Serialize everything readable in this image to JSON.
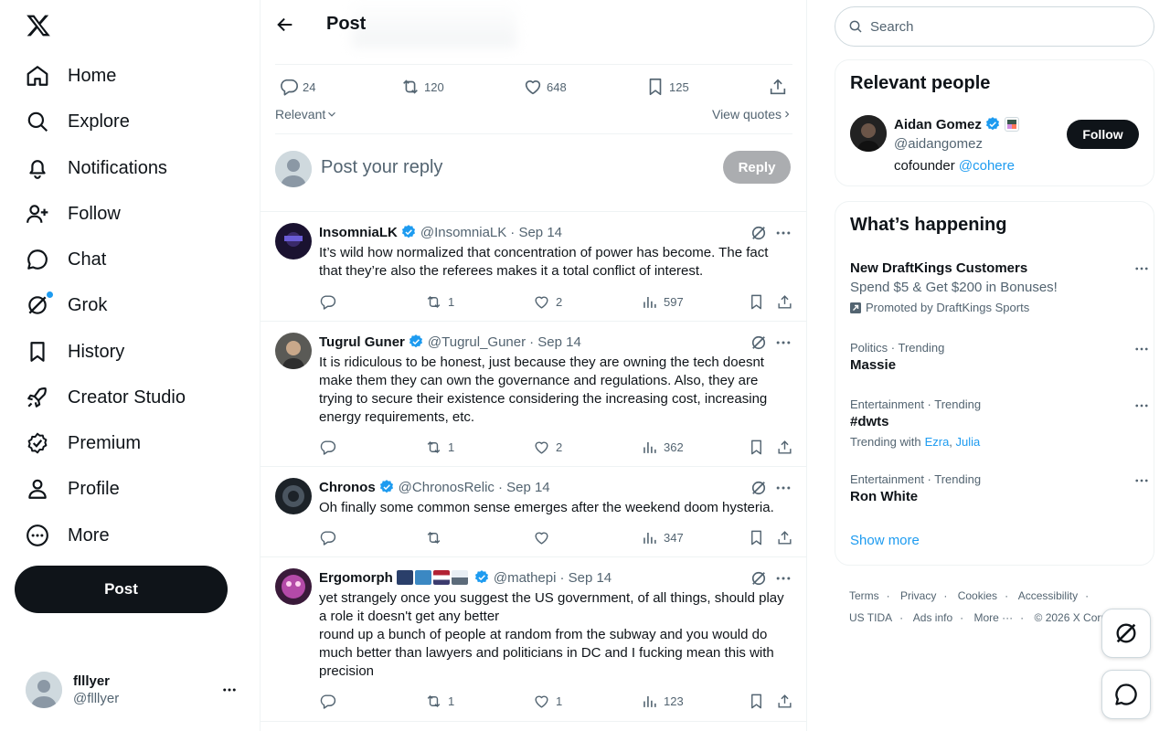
{
  "nav": {
    "items": [
      {
        "label": "Home",
        "icon": "home-icon"
      },
      {
        "label": "Explore",
        "icon": "search-icon"
      },
      {
        "label": "Notifications",
        "icon": "bell-icon"
      },
      {
        "label": "Follow",
        "icon": "person-plus-icon"
      },
      {
        "label": "Chat",
        "icon": "chat-bubble-icon"
      },
      {
        "label": "Grok",
        "icon": "grok-icon"
      },
      {
        "label": "History",
        "icon": "bookmark-icon"
      },
      {
        "label": "Creator Studio",
        "icon": "rocket-icon"
      },
      {
        "label": "Premium",
        "icon": "verified-badge-icon"
      },
      {
        "label": "Profile",
        "icon": "person-icon"
      },
      {
        "label": "More",
        "icon": "more-circle-icon"
      }
    ],
    "post_label": "Post"
  },
  "account": {
    "display_name": "flllyer",
    "handle": "@flllyer"
  },
  "header": {
    "title": "Post"
  },
  "stats": {
    "replies": "24",
    "reposts": "120",
    "likes": "648",
    "bookmarks": "125"
  },
  "sort": {
    "label": "Relevant",
    "view_quotes": "View quotes"
  },
  "reply_box": {
    "placeholder": "Post your reply",
    "button": "Reply"
  },
  "tweets": [
    {
      "name": "InsomniaLK",
      "handle": "@InsomniaLK",
      "date": "· Sep 14",
      "text": "It’s wild how normalized that concentration of power has become. The fact that they’re also the referees makes it a total conflict of interest.",
      "replies": "",
      "reposts": "1",
      "likes": "2",
      "views": "597"
    },
    {
      "name": "Tugrul Guner",
      "handle": "@Tugrul_Guner",
      "date": "· Sep 14",
      "text": "It is ridiculous to be honest, just because they are owning the tech doesnt make them they can own the governance and regulations. Also, they are trying to secure their existence considering the increasing cost, increasing energy requirements, etc.",
      "replies": "",
      "reposts": "1",
      "likes": "2",
      "views": "362"
    },
    {
      "name": "Chronos",
      "handle": "@ChronosRelic",
      "date": "· Sep 14",
      "text": "Oh finally some common sense emerges after the weekend doom hysteria.",
      "replies": "",
      "reposts": "",
      "likes": "",
      "views": "347"
    },
    {
      "name": "Ergomorph",
      "handle": "@mathepi",
      "date": "· Sep 14",
      "text": "yet strangely once you suggest the US government, of all things, should play a role it doesn't get any better\nround up a bunch of people at random from the subway and you would do much better than lawyers and politicians in DC and I fucking mean this with precision",
      "replies": "",
      "reposts": "1",
      "likes": "1",
      "views": "123"
    }
  ],
  "search": {
    "placeholder": "Search"
  },
  "relevant": {
    "title": "Relevant people",
    "name": "Aidan Gomez",
    "handle": "@aidangomez",
    "bio_prefix": "cofounder",
    "bio_link": "@cohere",
    "follow": "Follow"
  },
  "happening": {
    "title": "What’s happening",
    "trends": [
      {
        "title": "New DraftKings Customers",
        "subtitle": "Spend $5 & Get $200 in Bonuses!",
        "promo": "Promoted by DraftKings Sports"
      },
      {
        "meta": "Politics · Trending",
        "title": "Massie"
      },
      {
        "meta": "Entertainment · Trending",
        "title": "#dwts",
        "with_label": "Trending with",
        "with_a": "Ezra",
        "with_b": "Julia"
      },
      {
        "meta": "Entertainment · Trending",
        "title": "Ron White"
      }
    ],
    "show_more": "Show more"
  },
  "footer": {
    "terms": "Terms",
    "privacy": "Privacy",
    "cookies": "Cookies",
    "accessibility": "Accessibility",
    "ustida": "US TIDA",
    "ads": "Ads info",
    "more": "More ···",
    "copyright": "© 2026 X Corp."
  },
  "colors": {
    "accent": "#1d9bf0",
    "text": "#0f1419",
    "muted": "#536471",
    "border": "#eff3f4"
  }
}
